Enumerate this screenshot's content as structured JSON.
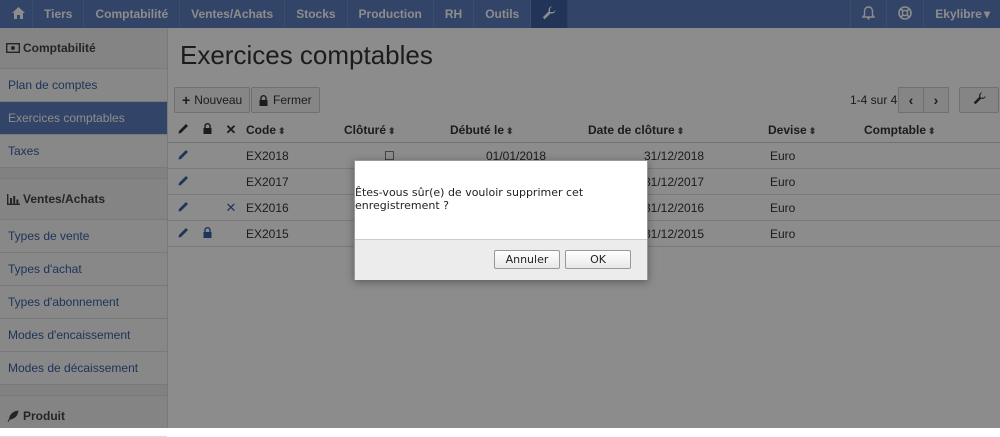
{
  "navbar": {
    "home_icon": "home-icon",
    "items": [
      "Tiers",
      "Comptabilité",
      "Ventes/Achats",
      "Stocks",
      "Production",
      "RH",
      "Outils"
    ],
    "tools_icon": "wrench-icon",
    "bell_icon": "bell-icon",
    "help_icon": "lifebuoy-icon",
    "user_label": "Ekylibre",
    "user_caret": "▾",
    "color": "#5b7fbf",
    "active_color": "#3f62a3"
  },
  "sidebar": {
    "sections": [
      {
        "title": "Comptabilité",
        "icon": "banknote-icon",
        "items": [
          {
            "label": "Plan de comptes",
            "active": false
          },
          {
            "label": "Exercices comptables",
            "active": true
          },
          {
            "label": "Taxes",
            "active": false
          }
        ]
      },
      {
        "title": "Ventes/Achats",
        "icon": "bar-chart-icon",
        "items": [
          {
            "label": "Types de vente",
            "active": false
          },
          {
            "label": "Types d'achat",
            "active": false
          },
          {
            "label": "Types d'abonnement",
            "active": false
          },
          {
            "label": "Modes d'encaissement",
            "active": false
          },
          {
            "label": "Modes de décaissement",
            "active": false
          }
        ]
      },
      {
        "title": "Produit",
        "icon": "feather-icon",
        "items": []
      }
    ]
  },
  "main": {
    "title": "Exercices comptables",
    "buttons": {
      "new": "Nouveau",
      "close": "Fermer"
    },
    "pager": {
      "text": "1-4 sur 4",
      "prev": "‹",
      "next": "›"
    },
    "columns": [
      "Code",
      "Clôturé",
      "Débuté le",
      "Date de clôture",
      "Devise",
      "Comptable"
    ],
    "sort_glyph": "⬍",
    "rows": [
      {
        "code": "EX2018",
        "closed": "☐",
        "started": "01/01/2018",
        "stopped": "31/12/2018",
        "currency": "Euro",
        "deletable": false,
        "locked": false
      },
      {
        "code": "EX2017",
        "closed": "",
        "started": "",
        "stopped": "31/12/2017",
        "currency": "Euro",
        "deletable": false,
        "locked": false
      },
      {
        "code": "EX2016",
        "closed": "",
        "started": "",
        "stopped": "31/12/2016",
        "currency": "Euro",
        "deletable": true,
        "locked": false
      },
      {
        "code": "EX2015",
        "closed": "",
        "started": "",
        "stopped": "31/12/2015",
        "currency": "Euro",
        "deletable": false,
        "locked": true
      }
    ]
  },
  "dialog": {
    "message": "Êtes-vous sûr(e) de vouloir supprimer cet enregistrement ?",
    "cancel_label": "Annuler",
    "ok_label": "OK"
  }
}
